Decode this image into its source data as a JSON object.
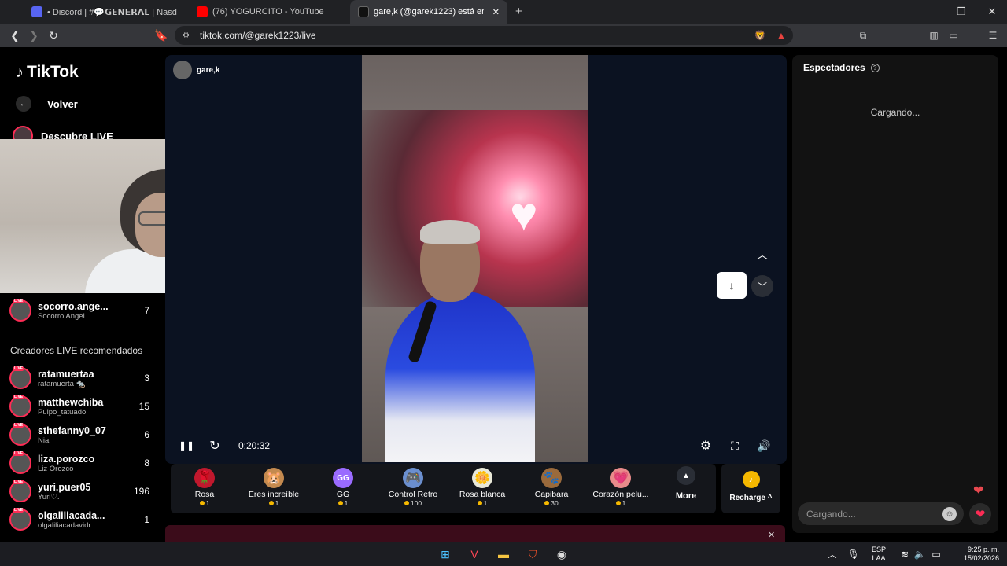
{
  "browser": {
    "tabs": [
      {
        "label": "• Discord | #💬𝗚𝗘𝗡𝗘𝗥𝗔𝗟 | Nasd",
        "fav_color": "#5865f2"
      },
      {
        "label": "(76) YOGURCITO - YouTube",
        "fav_color": "#ff0000"
      },
      {
        "label": "gare,k (@garek1223) está em",
        "fav_color": "#111111"
      }
    ],
    "new_tab": "+",
    "url": "tiktok.com/@garek1223/live"
  },
  "tiktok": {
    "logo": "TikTok",
    "back": "Volver",
    "discover": "Descubre LIVE",
    "followed": [
      {
        "name": "socorro.ange...",
        "sub": "Socorro Angel",
        "count": "7"
      }
    ],
    "recommended_title": "Creadores LIVE recomendados",
    "recommended": [
      {
        "name": "ratamuertaa",
        "sub": "ratamuerta 🐀",
        "count": "3"
      },
      {
        "name": "matthewchiba",
        "sub": "Pulpo_tatuado",
        "count": "15"
      },
      {
        "name": "sthefanny0_07",
        "sub": "Nia",
        "count": "6"
      },
      {
        "name": "liza.porozco",
        "sub": "Liz Orozco",
        "count": "8"
      },
      {
        "name": "yuri.puer05",
        "sub": "Yuri♡.",
        "count": "196"
      },
      {
        "name": "olgaliliacada...",
        "sub": "olgaliliacadavidr",
        "count": "1"
      }
    ],
    "live_badge": "LIVE"
  },
  "player": {
    "host": "gare,k",
    "time": "0:20:32"
  },
  "gifts": [
    {
      "name": "Rosa",
      "price": "1",
      "icon": "🌹",
      "color": "#c0182d"
    },
    {
      "name": "Eres increíble",
      "price": "1",
      "icon": "🐹",
      "color": "#c48a4f"
    },
    {
      "name": "GG",
      "price": "1",
      "icon": "GG",
      "color": "#9a6bff"
    },
    {
      "name": "Control Retro",
      "price": "100",
      "icon": "🎮",
      "color": "#6b8fcf"
    },
    {
      "name": "Rosa blanca",
      "price": "1",
      "icon": "🌼",
      "color": "#e8e8d8"
    },
    {
      "name": "Capibara",
      "price": "30",
      "icon": "🐾",
      "color": "#9a6a3c"
    },
    {
      "name": "Corazón pelu...",
      "price": "1",
      "icon": "💗",
      "color": "#e98b8b"
    }
  ],
  "more_label": "More",
  "recharge_label": "Recharge ^",
  "viewers": {
    "title": "Espectadores",
    "loading": "Cargando...",
    "chat_placeholder": "Cargando..."
  },
  "taskbar": {
    "lang1": "ESP",
    "lang2": "LAA",
    "time": "9:25 p. m.",
    "date": "15/02/2026"
  }
}
